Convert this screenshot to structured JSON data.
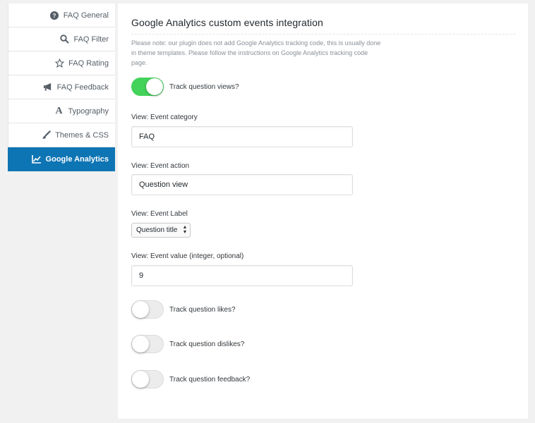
{
  "sidebar": {
    "items": [
      {
        "label": "FAQ General",
        "icon": "question-circle-icon",
        "active": false
      },
      {
        "label": "FAQ Filter",
        "icon": "search-icon",
        "active": false
      },
      {
        "label": "FAQ Rating",
        "icon": "star-icon",
        "active": false
      },
      {
        "label": "FAQ Feedback",
        "icon": "megaphone-icon",
        "active": false
      },
      {
        "label": "Typography",
        "icon": "typography-icon",
        "active": false
      },
      {
        "label": "Themes & CSS",
        "icon": "paintbrush-icon",
        "active": false
      },
      {
        "label": "Google Analytics",
        "icon": "chart-line-icon",
        "active": true
      }
    ]
  },
  "panel": {
    "title": "Google Analytics custom events integration",
    "note": "Please note: our plugin does not add Google Analytics tracking code, this is usually done in theme templates. Please follow the instructions on Google Analytics tracking code page.",
    "track_views": {
      "label": "Track question views?",
      "on": true
    },
    "category": {
      "label": "View: Event category",
      "value": "FAQ"
    },
    "action": {
      "label": "View: Event action",
      "value": "Question view"
    },
    "event_label": {
      "label": "View: Event Label",
      "selected": "Question title"
    },
    "event_value": {
      "label": "View: Event value (integer, optional)",
      "value": "9"
    },
    "track_likes": {
      "label": "Track question likes?",
      "on": false
    },
    "track_dislikes": {
      "label": "Track question dislikes?",
      "on": false
    },
    "track_feedback": {
      "label": "Track question feedback?",
      "on": false
    }
  },
  "colors": {
    "accent": "#0e75b4",
    "toggle_on": "#43d35b",
    "background": "#f1f1f1"
  }
}
